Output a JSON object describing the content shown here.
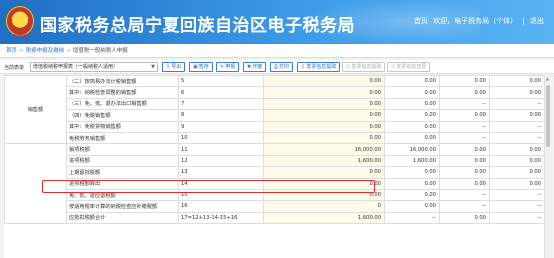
{
  "header": {
    "app_title": "国家税务总局宁夏回族自治区电子税务局",
    "logo_text": "中国税务",
    "links": [
      "首页",
      "欢迎，电子税务局（个体）",
      "|",
      "退出"
    ]
  },
  "breadcrumb": [
    "首页",
    "税费申报及缴纳",
    "增值税一般纳税人申报"
  ],
  "toolbar": {
    "report_label": "当前表单",
    "report_select": "增值税纳税申报表（一般纳税人适用）",
    "buttons": [
      {
        "label": "导出",
        "icon": "⇪",
        "enabled": true
      },
      {
        "label": "暂存",
        "icon": "▣",
        "enabled": true
      },
      {
        "label": "申报",
        "icon": "✎",
        "enabled": true
      },
      {
        "label": "作废",
        "icon": "✖",
        "enabled": true
      },
      {
        "label": "打印",
        "icon": "⎙",
        "enabled": true
      },
      {
        "label": "发票信息提取",
        "icon": "⇩",
        "enabled": true
      },
      {
        "label": "发票信息提取",
        "icon": "↻",
        "enabled": false
      },
      {
        "label": "发票信息还原",
        "icon": "↺",
        "enabled": false
      }
    ]
  },
  "table": {
    "category_sales": "销售额",
    "rows": [
      {
        "name": "（二）按简易办法计税销售额",
        "line": "5",
        "c1": "0.00",
        "c2": "0.00",
        "c3": "0.00",
        "c4": "0.00"
      },
      {
        "name": "其中：纳税检查调整的销售额",
        "line": "6",
        "c1": "0.00",
        "c2": "0.00",
        "c3": "0.00",
        "c4": "0.00"
      },
      {
        "name": "（三）免、抵、退办法出口销售额",
        "line": "7",
        "c1": "0.00",
        "c2": "0.00",
        "c3": "--",
        "c4": "--"
      },
      {
        "name": "（四）免税销售额",
        "line": "8",
        "c1": "0.00",
        "c2": "0.00",
        "c3": "0.00",
        "c4": "0.00"
      },
      {
        "name": "其中：免税货物销售额",
        "line": "9",
        "c1": "0.00",
        "c2": "0.00",
        "c3": "--",
        "c4": "--"
      },
      {
        "name": "免税劳务销售额",
        "line": "10",
        "c1": "0.00",
        "c2": "0.00",
        "c3": "--",
        "c4": "--"
      },
      {
        "name": "销项税额",
        "line": "11",
        "c1": "16,000.00",
        "c2": "16,000.00",
        "c3": "0.00",
        "c4": "0.00"
      },
      {
        "name": "进项税额",
        "line": "12",
        "c1": "1,600.00",
        "c2": "1,600.00",
        "c3": "0.00",
        "c4": "0.00"
      },
      {
        "name": "上期留抵税额",
        "line": "13",
        "c1": "0.00",
        "c2": "0.00",
        "c3": "0.00",
        "c4": "0.00"
      },
      {
        "name": "进项税额转出",
        "line": "14",
        "c1": "0.00",
        "c2": "0.00",
        "c3": "0.00",
        "c4": "0.00"
      },
      {
        "name": "免、抵、退应退税额",
        "line": "15",
        "c1": "0.00",
        "c2": "0.00",
        "c3": "--",
        "c4": "--"
      },
      {
        "name": "按适用税率计算的纳税检查应补缴税额",
        "line": "16",
        "c1": "0",
        "c2": "0.00",
        "c3": "--",
        "c4": "--"
      },
      {
        "name": "应抵扣税额合计",
        "line": "17=12+13-14-15+16",
        "c1": "1,600.00",
        "c2": "--",
        "c3": "0.00",
        "c4": "--"
      }
    ]
  }
}
